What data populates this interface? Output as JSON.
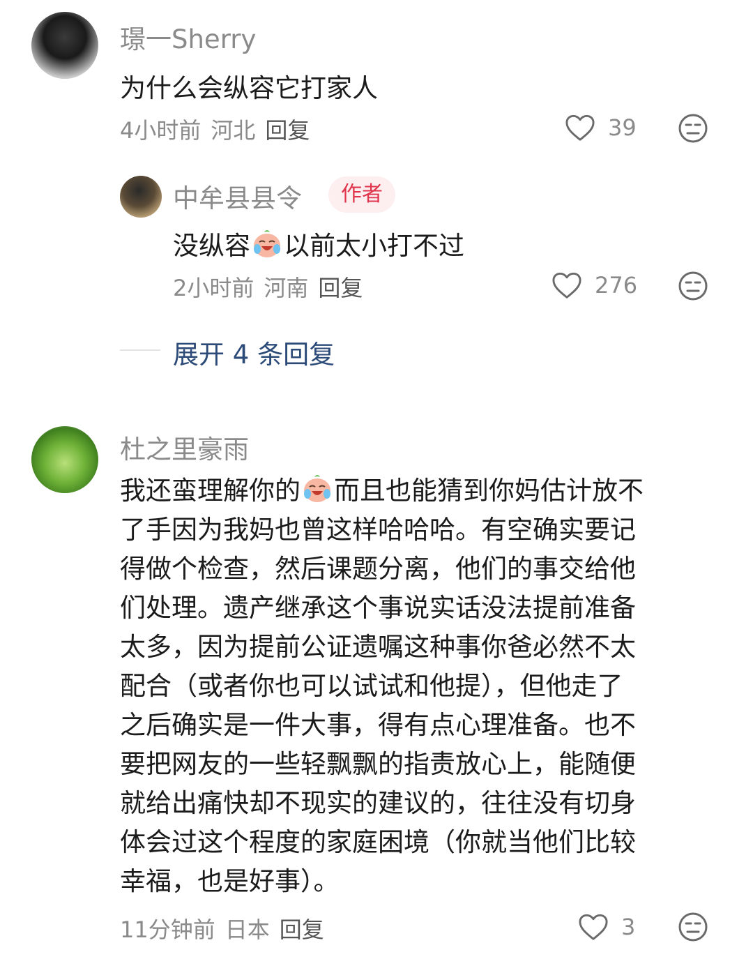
{
  "comments": [
    {
      "username": "璟一Sherry",
      "text": "为什么会纵容它打家人",
      "time": "4小时前",
      "location": "河北",
      "reply_label": "回复",
      "likes": "39",
      "replies": [
        {
          "username": "中牟县县令",
          "badge": "作者",
          "text_before_emoji": "没纵容",
          "text_after_emoji": "以前太小打不过",
          "emoji": "crying-laughing-face",
          "time": "2小时前",
          "location": "河南",
          "reply_label": "回复",
          "likes": "276"
        }
      ],
      "expand_label": "展开 4 条回复"
    },
    {
      "username": "杜之里豪雨",
      "emoji": "crying-laughing-face",
      "text_lines": [
        "我还蛮理解你的",
        "而且也能猜到你妈估计放不",
        "了手因为我妈也曾这样哈哈哈。有空确实要记",
        "得做个检查，然后课题分离，他们的事交给他",
        "们处理。遗产继承这个事说实话没法提前准备",
        "太多，因为提前公证遗嘱这种事你爸必然不太",
        "配合（或者你也可以试试和他提），但他走了",
        "之后确实是一件大事，得有点心理准备。也不",
        "要把网友的一些轻飘飘的指责放心上，能随便",
        "就给出痛快却不现实的建议的，往往没有切身",
        "体会过这个程度的家庭困境（你就当他们比较",
        "幸福，也是好事）。"
      ],
      "time": "11分钟前",
      "location": "日本",
      "reply_label": "回复",
      "likes": "3"
    }
  ],
  "colors": {
    "username": "#8a8a8a",
    "text": "#1b1b1b",
    "badge_bg": "#fdeef0",
    "badge_text": "#e0344c",
    "expand_link": "#2b4a78"
  },
  "icons": {
    "like": "heart-outline-icon",
    "dislike": "unamused-face-icon"
  }
}
